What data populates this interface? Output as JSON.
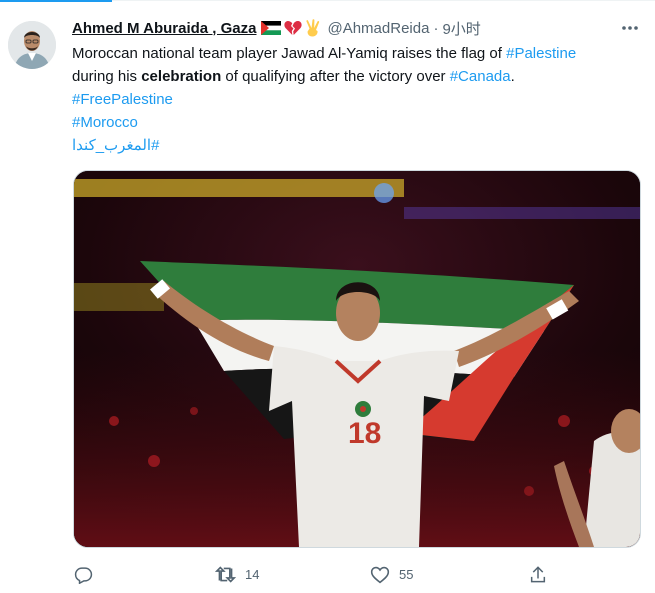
{
  "tweet": {
    "author_name": "Ahmed M Aburaida , Gaza",
    "badges": [
      "palestine-flag-icon",
      "broken-heart-icon",
      "victory-hand-icon"
    ],
    "handle": "@AhmadReida",
    "separator": "·",
    "time": "9小时",
    "text": {
      "line1_a": "Moroccan national team player Jawad Al-Yamiq raises the flag of ",
      "line1_link": "#Palestine",
      "line2_a": "during his ",
      "line2_bold": "celebration",
      "line2_b": " of qualifying after the victory over ",
      "line2_link": "#Canada",
      "line2_c": ".",
      "hashtag1": "#FreePalestine",
      "hashtag2": "#Morocco",
      "hashtag3": "#المغرب_كندا"
    },
    "jersey_number": "18",
    "media_icon": "photo-footballer-with-palestinian-flag"
  },
  "actions": {
    "reply_count": "",
    "retweet_count": "14",
    "like_count": "55",
    "share_icon": "share-icon"
  },
  "colors": {
    "link": "#1d9bf0",
    "secondary_text": "#536471",
    "flag_green": "#2f7d3c",
    "flag_red": "#d63a2f"
  }
}
